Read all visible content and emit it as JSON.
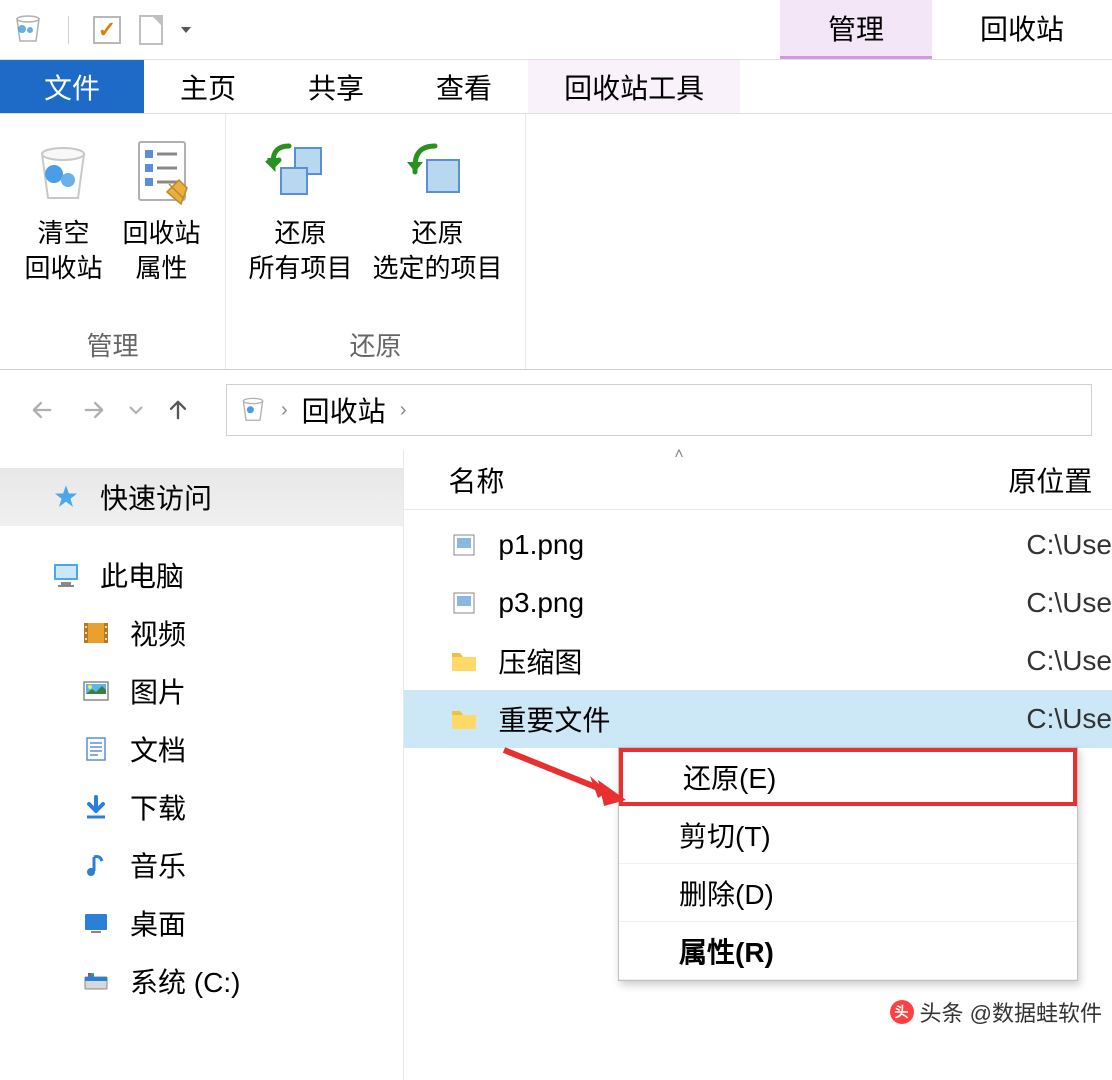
{
  "title_bar": {
    "manage_tab": "管理",
    "window_title": "回收站"
  },
  "ribbon_tabs": {
    "file": "文件",
    "home": "主页",
    "share": "共享",
    "view": "查看",
    "tools": "回收站工具"
  },
  "ribbon": {
    "group_manage": {
      "label": "管理",
      "empty_label": "清空\n回收站",
      "properties_label": "回收站\n属性"
    },
    "group_restore": {
      "label": "还原",
      "restore_all_label": "还原\n所有项目",
      "restore_selected_label": "还原\n选定的项目"
    }
  },
  "breadcrumb": {
    "location": "回收站"
  },
  "sidebar": {
    "quick_access": "快速访问",
    "this_pc": "此电脑",
    "items": [
      {
        "label": "视频"
      },
      {
        "label": "图片"
      },
      {
        "label": "文档"
      },
      {
        "label": "下载"
      },
      {
        "label": "音乐"
      },
      {
        "label": "桌面"
      },
      {
        "label": "系统 (C:)"
      }
    ]
  },
  "file_list": {
    "headers": {
      "name": "名称",
      "location": "原位置"
    },
    "rows": [
      {
        "name": "p1.png",
        "location": "C:\\Use",
        "type": "image"
      },
      {
        "name": "p3.png",
        "location": "C:\\Use",
        "type": "image"
      },
      {
        "name": "压缩图",
        "location": "C:\\Use",
        "type": "folder"
      },
      {
        "name": "重要文件",
        "location": "C:\\Use",
        "type": "folder",
        "selected": true
      }
    ]
  },
  "context_menu": {
    "restore": "还原(E)",
    "cut": "剪切(T)",
    "delete": "删除(D)",
    "properties": "属性(R)"
  },
  "watermark": "头条 @数据蛙软件"
}
